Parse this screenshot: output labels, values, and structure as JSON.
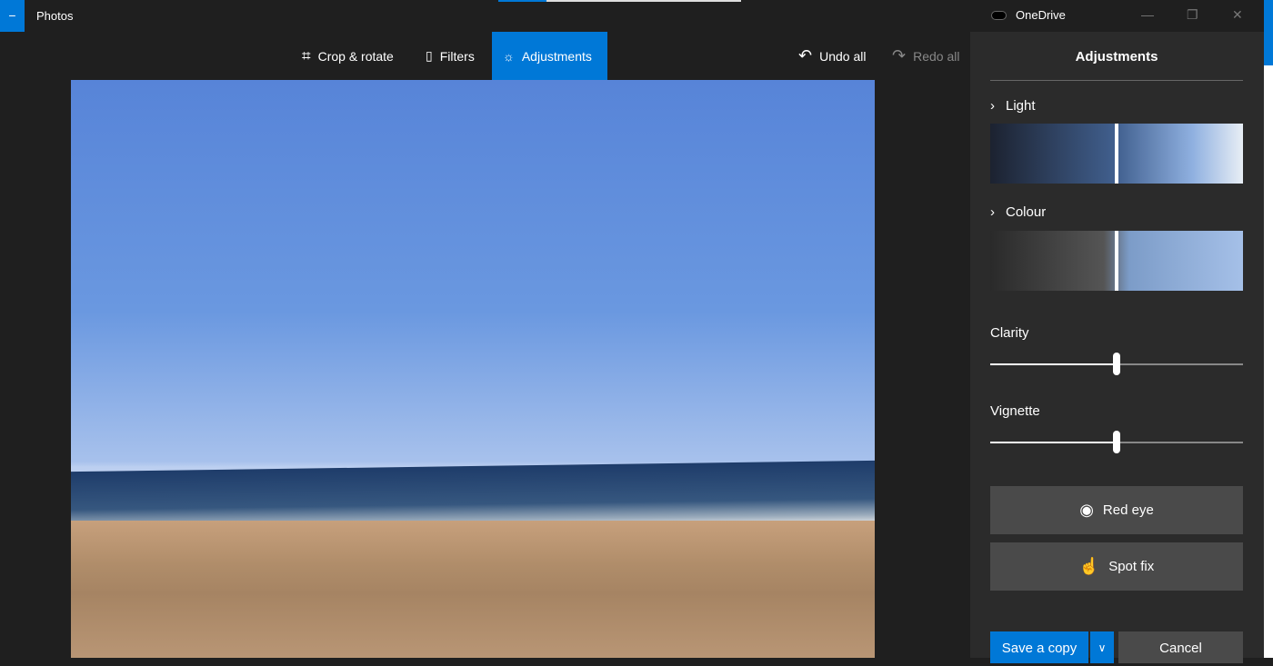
{
  "app": {
    "title": "Photos",
    "back_icon": "back-icon"
  },
  "toolbar": {
    "crop": "Crop & rotate",
    "filters": "Filters",
    "adjustments": "Adjustments",
    "undo": "Undo all",
    "redo": "Redo all"
  },
  "window": {
    "onedrive": "OneDrive",
    "minimize": "—",
    "restore": "❐",
    "close": "✕"
  },
  "panel": {
    "title": "Adjustments",
    "light": "Light",
    "colour": "Colour",
    "light_value": 0.5,
    "colour_value": 0.5,
    "clarity": {
      "label": "Clarity",
      "value": 0.5
    },
    "vignette": {
      "label": "Vignette",
      "value": 0.5
    },
    "red_eye": "Red eye",
    "spot_fix": "Spot fix",
    "save": "Save a copy",
    "cancel": "Cancel"
  },
  "colors": {
    "accent": "#0078d7",
    "panel": "#2b2b2b",
    "background": "#1f1f1f"
  }
}
